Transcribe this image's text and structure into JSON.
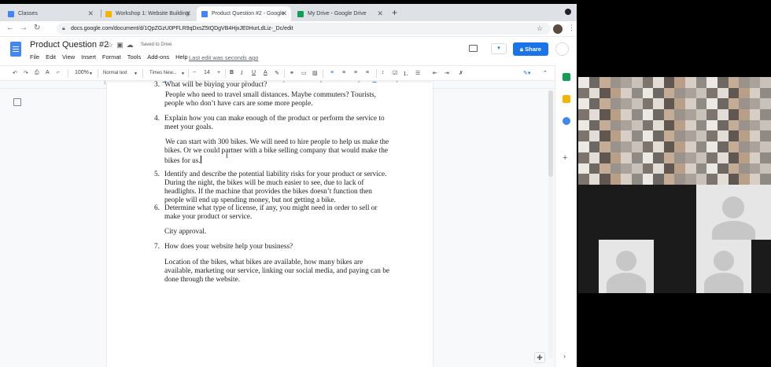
{
  "browser": {
    "tabs": [
      {
        "title": "Classes",
        "favicon_color": "#4285f4"
      },
      {
        "title": "Workshop 1: Website Building",
        "favicon_color": "#f4b400"
      },
      {
        "title": "Product Question #2 - Google",
        "favicon_color": "#4285f4"
      },
      {
        "title": "My Drive - Google Drive",
        "favicon_color": "#0f9d58"
      }
    ],
    "url": "docs.google.com/document/d/1QpZGzU0PFLR9qDxsZ5tQDgVB4HjxJE0HurLdLiz-_Dc/edit"
  },
  "docs": {
    "title": "Product Question #2",
    "saved_status": "Saved to Drive",
    "menu": [
      "File",
      "Edit",
      "View",
      "Insert",
      "Format",
      "Tools",
      "Add-ons",
      "Help"
    ],
    "last_edit": "Last edit was seconds ago",
    "share_label": "Share"
  },
  "toolbar": {
    "zoom": "100%",
    "style": "Normal text",
    "font": "Times New...",
    "font_size": "14"
  },
  "ruler": {
    "numbers": [
      "1",
      "1",
      "2",
      "3",
      "4",
      "5",
      "6",
      "7"
    ]
  },
  "document": {
    "lines": [
      {
        "num": "3.",
        "text": "What will be buying your product?",
        "cut": true
      },
      {
        "text": " People who need to travel small distances. Maybe commuters? Tourists,"
      },
      {
        "text": "people who don’t have cars are some more people."
      },
      {
        "num": "4.",
        "text": "Explain how you can make enough of the product or perform the service to"
      },
      {
        "text": "meet your goals."
      },
      {
        "text": " We can start with 300 bikes. We will need to hire people to help us make the"
      },
      {
        "text": "bikes. Or we could partner with a bike selling company that would make the"
      },
      {
        "text": "bikes for us.",
        "cursor": true
      },
      {
        "num": "5.",
        "text": "Identify and describe the potential liability risks for your product or service."
      },
      {
        "text": "During the night, the bikes will be much easier to see, due to lack of"
      },
      {
        "text": "headlights. If the machine that provides the bikes doesn’t function then"
      },
      {
        "text": "people will end up spending money, but not getting a bike."
      },
      {
        "num": "6.",
        "text": "Determine what type of license, if any, you might need in order to sell or"
      },
      {
        "text": "make your product or service."
      },
      {
        "text": "City approval."
      },
      {
        "num": "7.",
        "text": "How does your website help your business?"
      },
      {
        "text": "Location of the bikes, what bikes are available, how many bikes are"
      },
      {
        "text": "available, marketing our service, linking our social media, and paying can be"
      },
      {
        "text": "done through the website."
      }
    ]
  },
  "colors": {
    "accent": "#1a73e8",
    "docs_blue": "#4285f4"
  }
}
